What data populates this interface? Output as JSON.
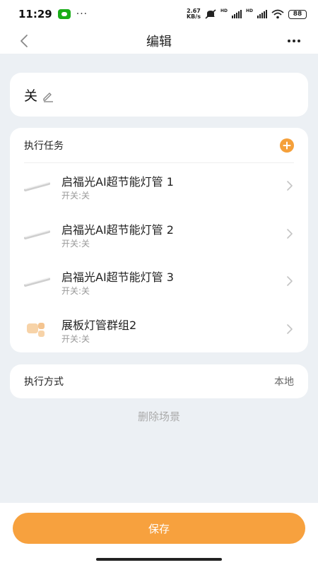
{
  "status_bar": {
    "time": "11:29",
    "dots": "···",
    "net_speed_value": "2.67",
    "net_speed_unit": "KB/s",
    "hd1": "HD",
    "hd2": "HD",
    "battery": "88"
  },
  "nav": {
    "title": "编辑"
  },
  "scene": {
    "name": "关"
  },
  "tasks": {
    "header": "执行任务",
    "items": [
      {
        "name": "启福光AI超节能灯管 1",
        "state": "开关:关",
        "icon": "light-tube-icon"
      },
      {
        "name": "启福光AI超节能灯管 2",
        "state": "开关:关",
        "icon": "light-tube-icon"
      },
      {
        "name": "启福光AI超节能灯管 3",
        "state": "开关:关",
        "icon": "light-tube-icon"
      },
      {
        "name": "展板灯管群组2",
        "state": "开关:关",
        "icon": "device-group-icon"
      }
    ]
  },
  "execution": {
    "label": "执行方式",
    "value": "本地"
  },
  "delete_label": "删除场景",
  "save_label": "保存",
  "colors": {
    "accent": "#f7a13e",
    "background": "#ecf0f4"
  }
}
